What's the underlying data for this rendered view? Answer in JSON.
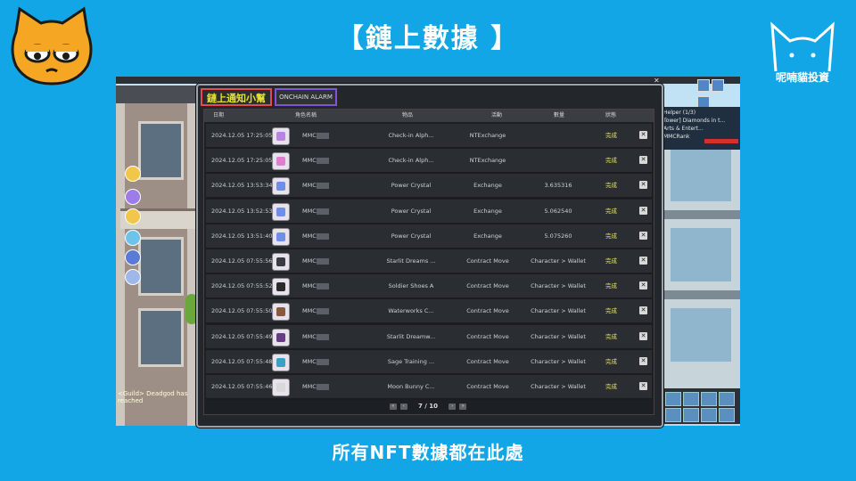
{
  "slide": {
    "title": "【鏈上數據 】",
    "caption": "所有NFT數據都在此處",
    "brand": "呢喃貓投資"
  },
  "game": {
    "chat_line": "<Guild> Deadgod has reached",
    "helper_title": "Helper (1/3)",
    "helper_line1": "Tower] Diamonds in t...",
    "helper_line2": "Arts & Entert...",
    "helper_name": "MMCRank"
  },
  "popup": {
    "tab_active": "鏈上通知小幫手",
    "tab_alt": "ONCHAIN ALARM",
    "columns": [
      "日期",
      "角色名稱",
      "物品",
      "活動",
      "數量",
      "狀態"
    ],
    "rows": [
      {
        "date": "2024.12.05 17:25:05",
        "char": "MMC",
        "item": "Check-in Alph...",
        "activity": "NTExchange",
        "qty": "",
        "status": "完成",
        "icon_color": "#b884e0"
      },
      {
        "date": "2024.12.05 17:25:05",
        "char": "MMC",
        "item": "Check-in Alph...",
        "activity": "NTExchange",
        "qty": "",
        "status": "完成",
        "icon_color": "#e07fd0"
      },
      {
        "date": "2024.12.05 13:53:34",
        "char": "MMC",
        "item": "Power Crystal",
        "activity": "Exchange",
        "qty": "3.635316",
        "status": "完成",
        "icon_color": "#6e8fe8"
      },
      {
        "date": "2024.12.05 13:52:53",
        "char": "MMC",
        "item": "Power Crystal",
        "activity": "Exchange",
        "qty": "5.062540",
        "status": "完成",
        "icon_color": "#6e8fe8"
      },
      {
        "date": "2024.12.05 13:51:40",
        "char": "MMC",
        "item": "Power Crystal",
        "activity": "Exchange",
        "qty": "5.075260",
        "status": "完成",
        "icon_color": "#6e8fe8"
      },
      {
        "date": "2024.12.05 07:55:56",
        "char": "MMC",
        "item": "Starlit Dreams ...",
        "activity": "Contract Move",
        "qty": "Character > Wallet",
        "status": "完成",
        "icon_color": "#3b3b44"
      },
      {
        "date": "2024.12.05 07:55:52",
        "char": "MMC",
        "item": "Soldier Shoes A",
        "activity": "Contract Move",
        "qty": "Character > Wallet",
        "status": "完成",
        "icon_color": "#2b2b2b"
      },
      {
        "date": "2024.12.05 07:55:50",
        "char": "MMC",
        "item": "Waterworks C...",
        "activity": "Contract Move",
        "qty": "Character > Wallet",
        "status": "完成",
        "icon_color": "#8a5a3a"
      },
      {
        "date": "2024.12.05 07:55:49",
        "char": "MMC",
        "item": "Starlit Dreamw...",
        "activity": "Contract Move",
        "qty": "Character > Wallet",
        "status": "完成",
        "icon_color": "#6a3a8a"
      },
      {
        "date": "2024.12.05 07:55:48",
        "char": "MMC",
        "item": "Sage Training ...",
        "activity": "Contract Move",
        "qty": "Character > Wallet",
        "status": "完成",
        "icon_color": "#3aa0c8"
      },
      {
        "date": "2024.12.05 07:55:46",
        "char": "MMC",
        "item": "Moon Bunny C...",
        "activity": "Contract Move",
        "qty": "Character > Wallet",
        "status": "完成",
        "icon_color": "#d8d8d8"
      }
    ],
    "pager": {
      "current": "7",
      "total": "10",
      "text": "7 / 10"
    }
  },
  "icons": {
    "delete": "close-icon",
    "pager_first": "double-chevron-left-icon",
    "pager_prev": "chevron-left-icon",
    "pager_next": "chevron-right-icon",
    "pager_last": "double-chevron-right-icon"
  }
}
